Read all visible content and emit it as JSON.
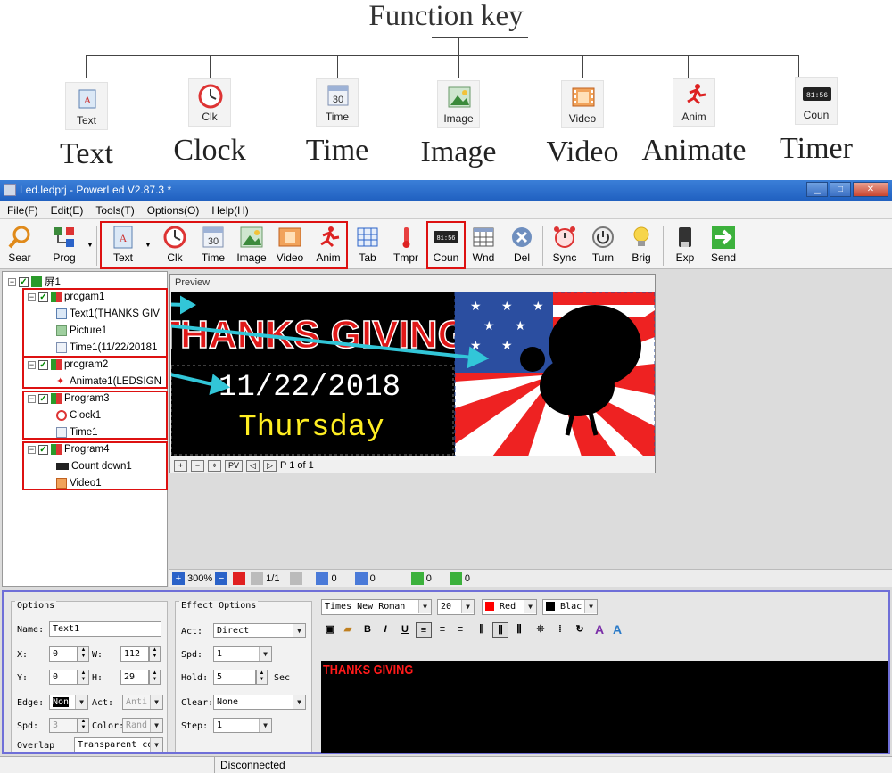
{
  "diagram": {
    "title": "Function key",
    "keys": [
      {
        "icon": "text-icon",
        "caption": "Text",
        "label": "Text"
      },
      {
        "icon": "clock-icon",
        "caption": "Clk",
        "label": "Clock"
      },
      {
        "icon": "calendar-icon",
        "caption": "Time",
        "label": "Time"
      },
      {
        "icon": "image-icon",
        "caption": "Image",
        "label": "Image"
      },
      {
        "icon": "film-icon",
        "caption": "Video",
        "label": "Video"
      },
      {
        "icon": "runner-icon",
        "caption": "Anim",
        "label": "Animate"
      },
      {
        "icon": "counter-icon",
        "caption": "Coun",
        "label": "Timer"
      }
    ]
  },
  "window": {
    "title": "Led.ledprj - PowerLed V2.87.3 *",
    "min": "▁",
    "max": "□",
    "close": "✕"
  },
  "menu": [
    "File(F)",
    "Edit(E)",
    "Tools(T)",
    "Options(O)",
    "Help(H)"
  ],
  "toolbar": {
    "sear": "Sear",
    "prog": "Prog",
    "text": "Text",
    "clk": "Clk",
    "time": "Time",
    "image": "Image",
    "video": "Video",
    "anim": "Anim",
    "tab": "Tab",
    "tmpr": "Tmpr",
    "coun": "Coun",
    "wnd": "Wnd",
    "del": "Del",
    "sync": "Sync",
    "turn": "Turn",
    "brig": "Brig",
    "exp": "Exp",
    "send": "Send",
    "calendar_num": "30",
    "counter_num": "81:56"
  },
  "tree": {
    "root": "屏1",
    "nodes": [
      {
        "label": "progam1"
      },
      {
        "label": "Text1(THANKS GIV"
      },
      {
        "label": "Picture1"
      },
      {
        "label": "Time1(11/22/20181"
      },
      {
        "label": "program2"
      },
      {
        "label": "Animate1(LEDSIGN"
      },
      {
        "label": "Program3"
      },
      {
        "label": "Clock1"
      },
      {
        "label": "Time1"
      },
      {
        "label": "Program4"
      },
      {
        "label": "Count down1"
      },
      {
        "label": "Video1"
      }
    ]
  },
  "preview": {
    "title": "Preview",
    "banner": "THANKS GIVING",
    "date": "11/22/2018",
    "day": "Thursday",
    "page": "P 1 of 1",
    "pv": "PV"
  },
  "zoombar": {
    "zoom": "300%",
    "page": "1/1",
    "v1": "0",
    "v2": "0",
    "v3": "0",
    "v4": "0"
  },
  "options": {
    "title": "Options",
    "name_label": "Name:",
    "name_value": "Text1",
    "x_label": "X:",
    "x_value": "0",
    "w_label": "W:",
    "w_value": "112",
    "y_label": "Y:",
    "y_value": "0",
    "h_label": "H:",
    "h_value": "29",
    "edge_label": "Edge:",
    "edge_value": "Non",
    "act_label": "Act:",
    "act_value": "Anti",
    "spd_label": "Spd:",
    "spd_value": "3",
    "color_label": "Color:",
    "color_value": "Rand",
    "overlap_label": "Overlap",
    "overlap_value": "Transparent co"
  },
  "effect": {
    "title": "Effect Options",
    "act_label": "Act:",
    "act_value": "Direct",
    "spd_label": "Spd:",
    "spd_value": "1",
    "hold_label": "Hold:",
    "hold_value": "5",
    "hold_unit": "Sec",
    "clear_label": "Clear:",
    "clear_value": "None",
    "step_label": "Step:",
    "step_value": "1"
  },
  "format": {
    "font": "Times New Roman",
    "size": "20",
    "fg": "Red",
    "fg_color": "#ff0000",
    "bg": "Blac",
    "bg_color": "#000000",
    "bold": "B",
    "italic": "I",
    "underline": "U",
    "a1": "A",
    "a2": "A"
  },
  "editor_text": "THANKS GIVING",
  "status": "Disconnected"
}
